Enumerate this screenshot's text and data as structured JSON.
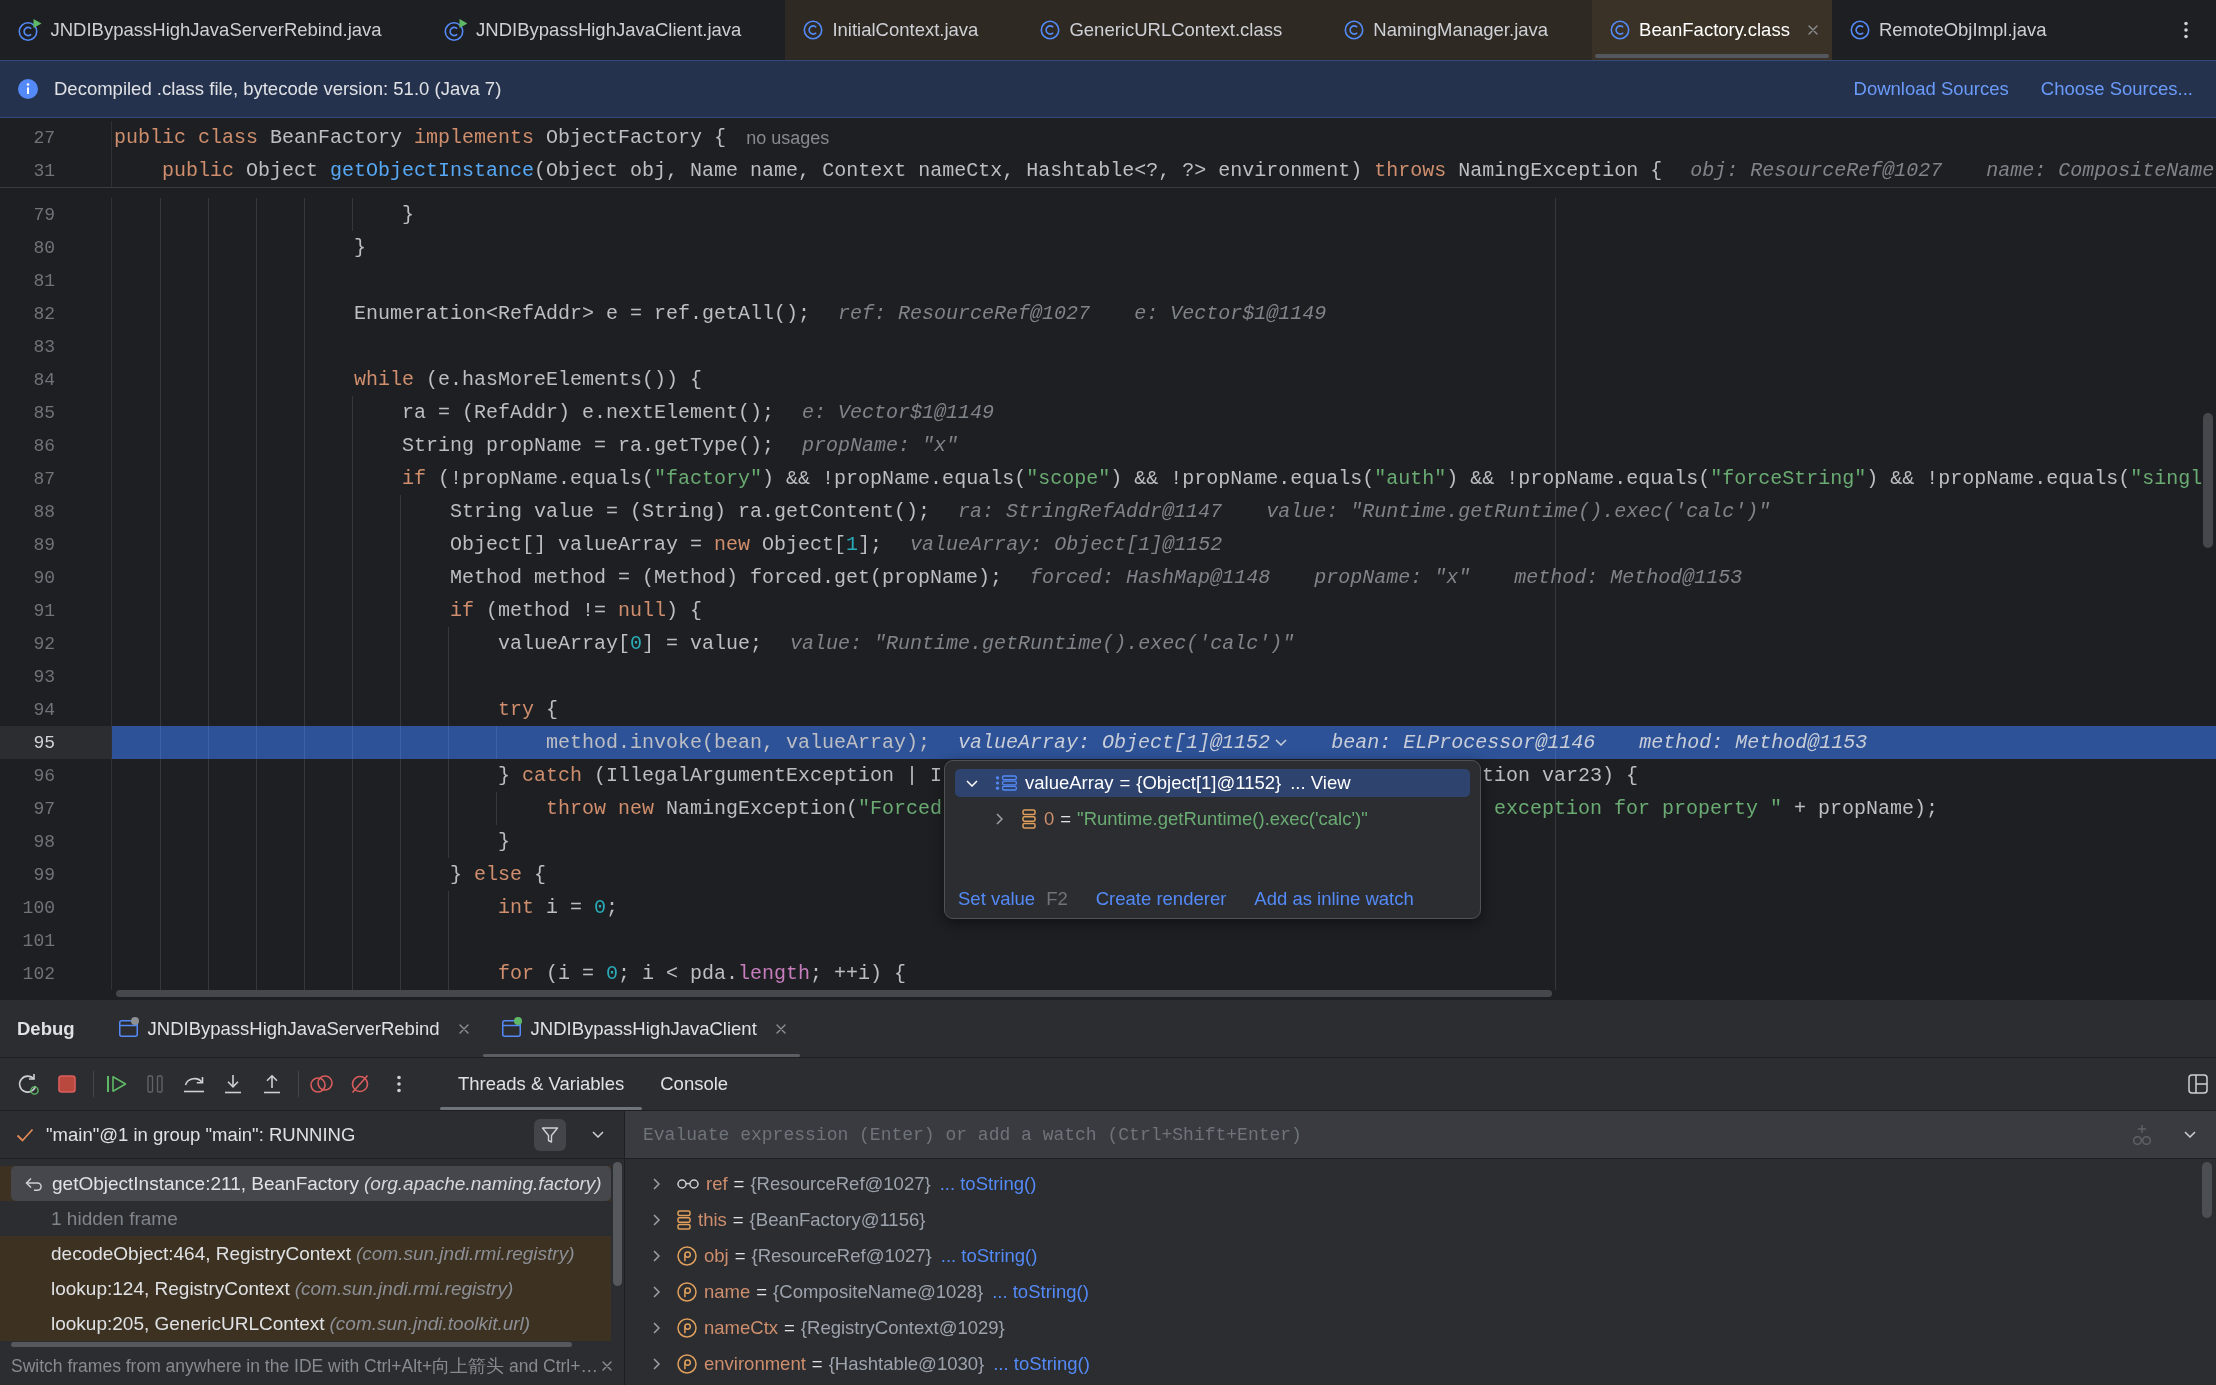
{
  "tabs": [
    {
      "label": "JNDIBypassHighJavaServerRebind.java",
      "kind": "runnable",
      "non_project": false,
      "selected": false
    },
    {
      "label": "JNDIBypassHighJavaClient.java",
      "kind": "runnable",
      "non_project": false,
      "selected": false
    },
    {
      "label": "InitialContext.java",
      "kind": "class",
      "non_project": true,
      "selected": false
    },
    {
      "label": "GenericURLContext.class",
      "kind": "class",
      "non_project": true,
      "selected": false
    },
    {
      "label": "NamingManager.java",
      "kind": "class",
      "non_project": true,
      "selected": false
    },
    {
      "label": "BeanFactory.class",
      "kind": "class",
      "non_project": true,
      "selected": true
    },
    {
      "label": "RemoteObjImpl.java",
      "kind": "class",
      "non_project": false,
      "selected": false
    }
  ],
  "banner": {
    "message": "Decompiled .class file, bytecode version: 51.0 (Java 7)",
    "links": [
      "Download Sources",
      "Choose Sources..."
    ]
  },
  "editor": {
    "sticky_lines": [
      {
        "number": "27",
        "code": [
          {
            "kind": "keyword",
            "text": "public class "
          },
          {
            "kind": "plain",
            "text": "BeanFactory "
          },
          {
            "kind": "keyword",
            "text": "implements "
          },
          {
            "kind": "plain",
            "text": "ObjectFactory {"
          }
        ],
        "hint": "no usages"
      },
      {
        "number": "31",
        "code": [
          {
            "kind": "keyword",
            "text": "    public "
          },
          {
            "kind": "plain",
            "text": "Object "
          },
          {
            "kind": "method",
            "text": "getObjectInstance"
          },
          {
            "kind": "plain",
            "text": "(Object obj, Name name, Context nameCtx, Hashtable<?, ?> environment) "
          },
          {
            "kind": "keyword",
            "text": "throws "
          },
          {
            "kind": "plain",
            "text": "NamingException {"
          }
        ],
        "values": [
          {
            "text": "obj: ResourceRef@1027"
          },
          {
            "text": "name: CompositeName"
          }
        ]
      }
    ],
    "lines": [
      {
        "number": "79",
        "current": false,
        "code": [
          {
            "kind": "plain",
            "text": "                        }"
          }
        ]
      },
      {
        "number": "80",
        "current": false,
        "code": [
          {
            "kind": "plain",
            "text": "                    }"
          }
        ]
      },
      {
        "number": "81",
        "current": false
      },
      {
        "number": "82",
        "current": false,
        "code": [
          {
            "kind": "plain",
            "text": "                    Enumeration<RefAddr> e = ref.getAll();"
          }
        ],
        "values": [
          {
            "text": "ref: ResourceRef@1027"
          },
          {
            "text": "e: Vector$1@1149"
          }
        ]
      },
      {
        "number": "83",
        "current": false
      },
      {
        "number": "84",
        "current": false,
        "code": [
          {
            "kind": "keyword",
            "text": "                    while "
          },
          {
            "kind": "plain",
            "text": "(e.hasMoreElements()) {"
          }
        ]
      },
      {
        "number": "85",
        "current": false,
        "code": [
          {
            "kind": "plain",
            "text": "                        ra = (RefAddr) e.nextElement();"
          }
        ],
        "values": [
          {
            "text": "e: Vector$1@1149"
          }
        ]
      },
      {
        "number": "86",
        "current": false,
        "code": [
          {
            "kind": "plain",
            "text": "                        String propName = ra.getType();"
          }
        ],
        "values": [
          {
            "text": "propName: \"x\""
          }
        ]
      },
      {
        "number": "87",
        "current": false,
        "code": [
          {
            "kind": "keyword",
            "text": "                        if "
          },
          {
            "kind": "plain",
            "text": "(!propName.equals("
          },
          {
            "kind": "string",
            "text": "\"factory\""
          },
          {
            "kind": "plain",
            "text": ") && !propName.equals("
          },
          {
            "kind": "string",
            "text": "\"scope\""
          },
          {
            "kind": "plain",
            "text": ") && !propName.equals("
          },
          {
            "kind": "string",
            "text": "\"auth\""
          },
          {
            "kind": "plain",
            "text": ") && !propName.equals("
          },
          {
            "kind": "string",
            "text": "\"forceString\""
          },
          {
            "kind": "plain",
            "text": ") && !propName.equals("
          },
          {
            "kind": "string",
            "text": "\"singl"
          }
        ]
      },
      {
        "number": "88",
        "current": false,
        "code": [
          {
            "kind": "plain",
            "text": "                            String value = (String) ra.getContent();"
          }
        ],
        "values": [
          {
            "text": "ra: StringRefAddr@1147"
          },
          {
            "text": "value: \"Runtime.getRuntime().exec('calc')\""
          }
        ]
      },
      {
        "number": "89",
        "current": false,
        "code": [
          {
            "kind": "plain",
            "text": "                            Object[] valueArray = "
          },
          {
            "kind": "keyword",
            "text": "new "
          },
          {
            "kind": "plain",
            "text": "Object["
          },
          {
            "kind": "number",
            "text": "1"
          },
          {
            "kind": "plain",
            "text": "];"
          }
        ],
        "values": [
          {
            "text": "valueArray: Object[1]@1152"
          }
        ]
      },
      {
        "number": "90",
        "current": false,
        "code": [
          {
            "kind": "plain",
            "text": "                            Method method = (Method) forced.get(propName);"
          }
        ],
        "values": [
          {
            "text": "forced: HashMap@1148"
          },
          {
            "text": "propName: \"x\""
          },
          {
            "text": "method: Method@1153"
          }
        ]
      },
      {
        "number": "91",
        "current": false,
        "code": [
          {
            "kind": "keyword",
            "text": "                            if "
          },
          {
            "kind": "plain",
            "text": "(method != "
          },
          {
            "kind": "keyword",
            "text": "null"
          },
          {
            "kind": "plain",
            "text": ") {"
          }
        ]
      },
      {
        "number": "92",
        "current": false,
        "code": [
          {
            "kind": "plain",
            "text": "                                valueArray["
          },
          {
            "kind": "number",
            "text": "0"
          },
          {
            "kind": "plain",
            "text": "] = value;"
          }
        ],
        "values": [
          {
            "text": "value: \"Runtime.getRuntime().exec('calc')\""
          }
        ]
      },
      {
        "number": "93",
        "current": false
      },
      {
        "number": "94",
        "current": false,
        "code": [
          {
            "kind": "keyword",
            "text": "                                try "
          },
          {
            "kind": "plain",
            "text": "{"
          }
        ]
      },
      {
        "number": "95",
        "current": true,
        "code": [
          {
            "kind": "plain",
            "text": "                                    method.invoke(bean, valueArray);"
          }
        ],
        "values": [
          {
            "text": "valueArray: Object[1]@1152",
            "dropdown": true
          },
          {
            "text": "bean: ELProcessor@1146"
          },
          {
            "text": "method: Method@1153"
          }
        ]
      },
      {
        "number": "96",
        "current": false,
        "code": [
          {
            "kind": "plain",
            "text": "                                } "
          },
          {
            "kind": "keyword",
            "text": "catch "
          },
          {
            "kind": "plain",
            "text": "(IllegalArgumentException | I"
          }
        ],
        "after_popup": [
          {
            "kind": "plain",
            "text": "tion var23) {"
          }
        ]
      },
      {
        "number": "97",
        "current": false,
        "code": [
          {
            "kind": "keyword",
            "text": "                                    throw new "
          },
          {
            "kind": "plain",
            "text": "NamingException("
          },
          {
            "kind": "string",
            "text": "\"Forced"
          }
        ],
        "after_popup": [
          {
            "kind": "string",
            "text": " exception for property \""
          },
          {
            "kind": "plain",
            "text": " + propName);"
          }
        ]
      },
      {
        "number": "98",
        "current": false,
        "code": [
          {
            "kind": "plain",
            "text": "                                }"
          }
        ]
      },
      {
        "number": "99",
        "current": false,
        "code": [
          {
            "kind": "plain",
            "text": "                            } "
          },
          {
            "kind": "keyword",
            "text": "else "
          },
          {
            "kind": "plain",
            "text": "{"
          }
        ]
      },
      {
        "number": "100",
        "current": false,
        "code": [
          {
            "kind": "keyword",
            "text": "                                int "
          },
          {
            "kind": "plain",
            "text": "i = "
          },
          {
            "kind": "number",
            "text": "0"
          },
          {
            "kind": "plain",
            "text": ";"
          }
        ]
      },
      {
        "number": "101",
        "current": false
      },
      {
        "number": "102",
        "current": false,
        "code": [
          {
            "kind": "keyword",
            "text": "                                for "
          },
          {
            "kind": "plain",
            "text": "(i = "
          },
          {
            "kind": "number",
            "text": "0"
          },
          {
            "kind": "plain",
            "text": "; i < pda."
          },
          {
            "kind": "field",
            "text": "length"
          },
          {
            "kind": "plain",
            "text": "; ++i) {"
          }
        ]
      }
    ],
    "popup": {
      "tree": [
        {
          "name": "valueArray",
          "sign": "=",
          "value": "{Object[1]@1152}",
          "link": "... View",
          "kind": "array",
          "expanded": true,
          "selected": true,
          "children": [
            {
              "name": "0",
              "sign": "=",
              "value": "\"Runtime.getRuntime().exec('calc')\"",
              "is_string": true,
              "kind": "field",
              "expanded": false,
              "selected": false
            }
          ]
        }
      ],
      "actions": [
        {
          "label": "Set value",
          "shortcut": "F2"
        },
        {
          "label": "Create renderer"
        },
        {
          "label": "Add as inline watch"
        }
      ]
    }
  },
  "debug": {
    "title": "Debug",
    "sessions": [
      {
        "label": "JNDIBypassHighJavaServerRebind",
        "color": "#8c8f94",
        "selected": false
      },
      {
        "label": "JNDIBypassHighJavaClient",
        "color": "#5fb865",
        "selected": true
      }
    ],
    "toolbar": [
      {
        "kind": "rerun",
        "disabled": false
      },
      {
        "kind": "stop",
        "disabled": false
      },
      {
        "kind": "separator"
      },
      {
        "kind": "resume",
        "disabled": false
      },
      {
        "kind": "pause",
        "disabled": true
      },
      {
        "kind": "stepover",
        "disabled": false
      },
      {
        "kind": "stepinto",
        "disabled": false
      },
      {
        "kind": "stepout",
        "disabled": false
      },
      {
        "kind": "separator"
      },
      {
        "kind": "breakpoints",
        "disabled": false
      },
      {
        "kind": "mute",
        "disabled": false
      },
      {
        "kind": "more",
        "disabled": false
      }
    ],
    "views": [
      {
        "label": "Threads & Variables",
        "selected": true
      },
      {
        "label": "Console",
        "selected": false
      }
    ],
    "thread": "\"main\"@1 in group \"main\": RUNNING",
    "frames": [
      {
        "kind": "frame",
        "location": "getObjectInstance:211, BeanFactory",
        "package": "(org.apache.naming.factory)",
        "selected": true,
        "non_project": true
      },
      {
        "kind": "hidden",
        "label": "1 hidden frame",
        "selected": false,
        "non_project": false
      },
      {
        "kind": "frame",
        "location": "decodeObject:464, RegistryContext",
        "package": "(com.sun.jndi.rmi.registry)",
        "selected": false,
        "non_project": true
      },
      {
        "kind": "frame",
        "location": "lookup:124, RegistryContext",
        "package": "(com.sun.jndi.rmi.registry)",
        "selected": false,
        "non_project": true
      },
      {
        "kind": "frame",
        "location": "lookup:205, GenericURLContext",
        "package": "(com.sun.jndi.toolkit.url)",
        "selected": false,
        "non_project": true
      }
    ],
    "tip": "Switch frames from anywhere in the IDE with Ctrl+Alt+向上箭头 and Ctrl+…",
    "evaluate": {
      "placeholder": "Evaluate expression (Enter) or add a watch (Ctrl+Shift+Enter)",
      "add_watch_disabled": true
    },
    "variables": [
      {
        "name": "ref",
        "sign": "=",
        "value": "{ResourceRef@1027}",
        "is_string": false,
        "link": "... toString()",
        "kind": "watch",
        "expanded": false,
        "selected": false
      },
      {
        "name": "this",
        "sign": "=",
        "value": "{BeanFactory@1156}",
        "is_string": false,
        "kind": "field",
        "expanded": false,
        "selected": false
      },
      {
        "name": "obj",
        "sign": "=",
        "value": "{ResourceRef@1027}",
        "is_string": false,
        "link": "... toString()",
        "kind": "parameter",
        "expanded": false,
        "selected": false
      },
      {
        "name": "name",
        "sign": "=",
        "value": "{CompositeName@1028}",
        "is_string": false,
        "link": "... toString()",
        "kind": "parameter",
        "expanded": false,
        "selected": false
      },
      {
        "name": "nameCtx",
        "sign": "=",
        "value": "{RegistryContext@1029}",
        "is_string": false,
        "kind": "parameter",
        "expanded": false,
        "selected": false
      },
      {
        "name": "environment",
        "sign": "=",
        "value": "{Hashtable@1030}",
        "is_string": false,
        "link": "... toString()",
        "kind": "parameter",
        "expanded": false,
        "selected": false
      }
    ]
  }
}
